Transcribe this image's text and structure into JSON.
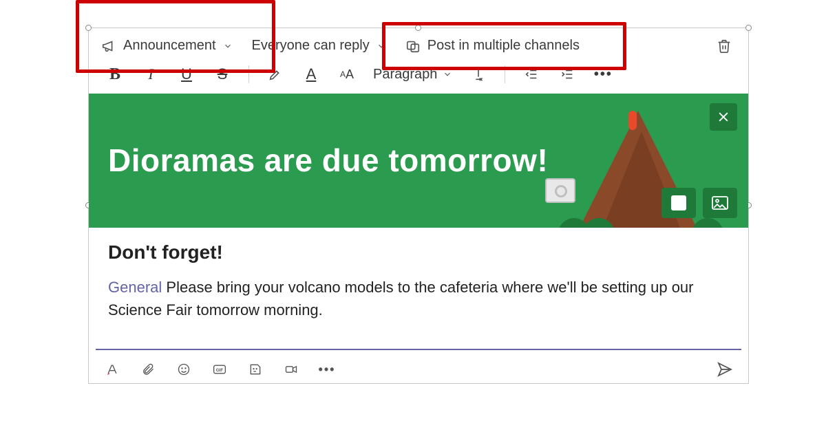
{
  "options": {
    "type_label": "Announcement",
    "reply_label": "Everyone can reply",
    "multi_label": "Post in multiple channels"
  },
  "format": {
    "paragraph_label": "Paragraph"
  },
  "banner": {
    "title": "Dioramas are due tomorrow!"
  },
  "body": {
    "subhead": "Don't forget!",
    "mention": "General",
    "text": "Please bring your volcano models to the cafeteria where we'll be setting up our Science Fair tomorrow morning."
  }
}
